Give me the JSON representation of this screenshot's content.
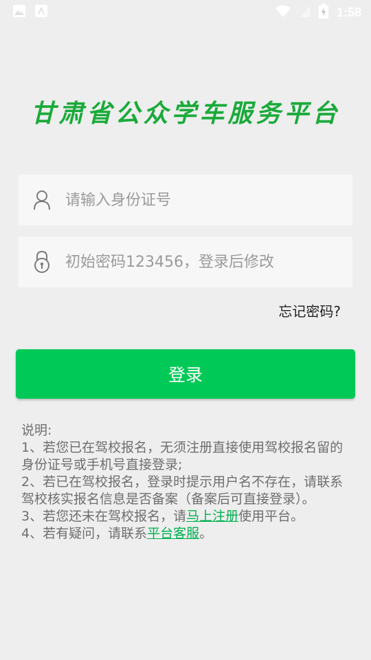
{
  "status_bar": {
    "time": "1:58",
    "left_icons": [
      "image-icon",
      "app-store-icon"
    ],
    "right_icons": [
      "wifi-icon",
      "signal-icon",
      "battery-icon"
    ]
  },
  "title": "甘肃省公众学车服务平台",
  "id_field": {
    "placeholder": "请输入身份证号",
    "value": "",
    "icon": "user-icon"
  },
  "password_field": {
    "placeholder": "初始密码123456，登录后修改",
    "value": "",
    "icon": "lock-icon"
  },
  "forgot_password": "忘记密码?",
  "login_button": "登录",
  "notes": {
    "heading": "说明:",
    "item1": "1、若您已在驾校报名，无须注册直接使用驾校报名留的身份证号或手机号直接登录;",
    "item2": "2、若已在驾校报名，登录时提示用户名不存在，请联系驾校核实报名信息是否备案（备案后可直接登录）。",
    "item3_pre": "3、若您还未在驾校报名，请",
    "item3_link": "马上注册",
    "item3_post": "使用平台。",
    "item4_pre": "4、若有疑问，请联系",
    "item4_link": "平台客服",
    "item4_post": "。"
  },
  "colors": {
    "accent": "#00c957",
    "title": "#1aaa3a",
    "link": "#00b050",
    "background": "#eeeeee"
  }
}
